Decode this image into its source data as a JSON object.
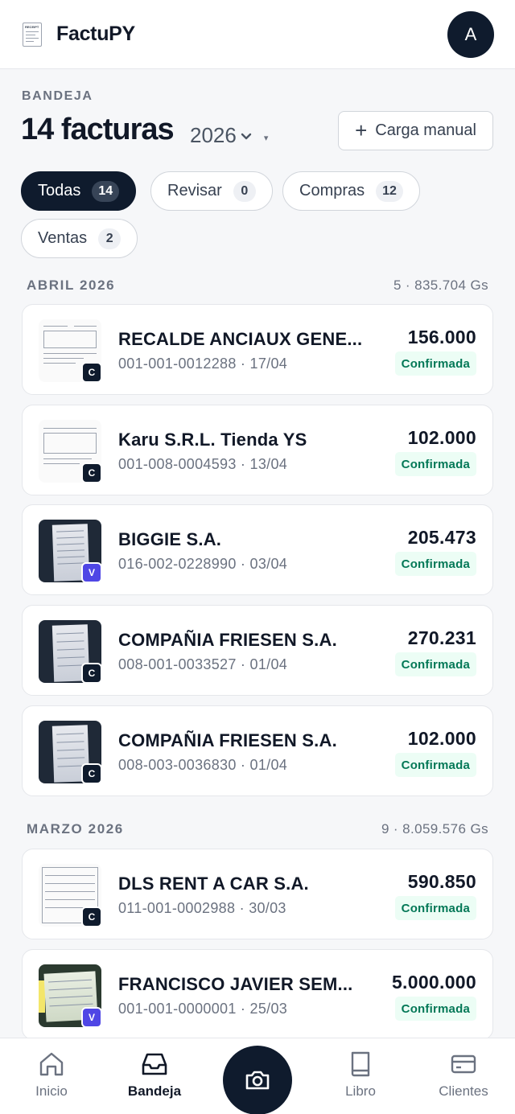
{
  "app": {
    "name": "FactuPY",
    "avatar_initial": "A"
  },
  "header_section": {
    "eyebrow": "BANDEJA",
    "title": "14 facturas",
    "year": "2026",
    "manual_button": "Carga manual"
  },
  "filters": [
    {
      "label": "Todas",
      "count": "14",
      "active": true
    },
    {
      "label": "Revisar",
      "count": "0",
      "active": false
    },
    {
      "label": "Compras",
      "count": "12",
      "active": false
    },
    {
      "label": "Ventas",
      "count": "2",
      "active": false
    }
  ],
  "months": [
    {
      "name": "ABRIL 2026",
      "summary": "5 · 835.704 Gs",
      "invoices": [
        {
          "name": "RECALDE ANCIAUX GENE...",
          "meta": "001-001-0012288 · 17/04",
          "amount": "156.000",
          "status": "Confirmada",
          "type": "C"
        },
        {
          "name": "Karu S.R.L. Tienda YS",
          "meta": "001-008-0004593 · 13/04",
          "amount": "102.000",
          "status": "Confirmada",
          "type": "C"
        },
        {
          "name": "BIGGIE S.A.",
          "meta": "016-002-0228990 · 03/04",
          "amount": "205.473",
          "status": "Confirmada",
          "type": "V"
        },
        {
          "name": "COMPAÑIA FRIESEN S.A.",
          "meta": "008-001-0033527 · 01/04",
          "amount": "270.231",
          "status": "Confirmada",
          "type": "C"
        },
        {
          "name": "COMPAÑIA FRIESEN S.A.",
          "meta": "008-003-0036830 · 01/04",
          "amount": "102.000",
          "status": "Confirmada",
          "type": "C"
        }
      ]
    },
    {
      "name": "MARZO 2026",
      "summary": "9 · 8.059.576 Gs",
      "invoices": [
        {
          "name": "DLS RENT A CAR S.A.",
          "meta": "011-001-0002988 · 30/03",
          "amount": "590.850",
          "status": "Confirmada",
          "type": "C"
        },
        {
          "name": "FRANCISCO JAVIER SEM...",
          "meta": "001-001-0000001 · 25/03",
          "amount": "5.000.000",
          "status": "Confirmada",
          "type": "V"
        }
      ]
    }
  ],
  "nav": {
    "home": "Inicio",
    "inbox": "Bandeja",
    "book": "Libro",
    "clients": "Clientes"
  },
  "colors": {
    "primary": "#0f1b2d",
    "status_bg": "#ecfdf5",
    "status_text": "#047857",
    "sale_badge": "#4f46e5"
  }
}
